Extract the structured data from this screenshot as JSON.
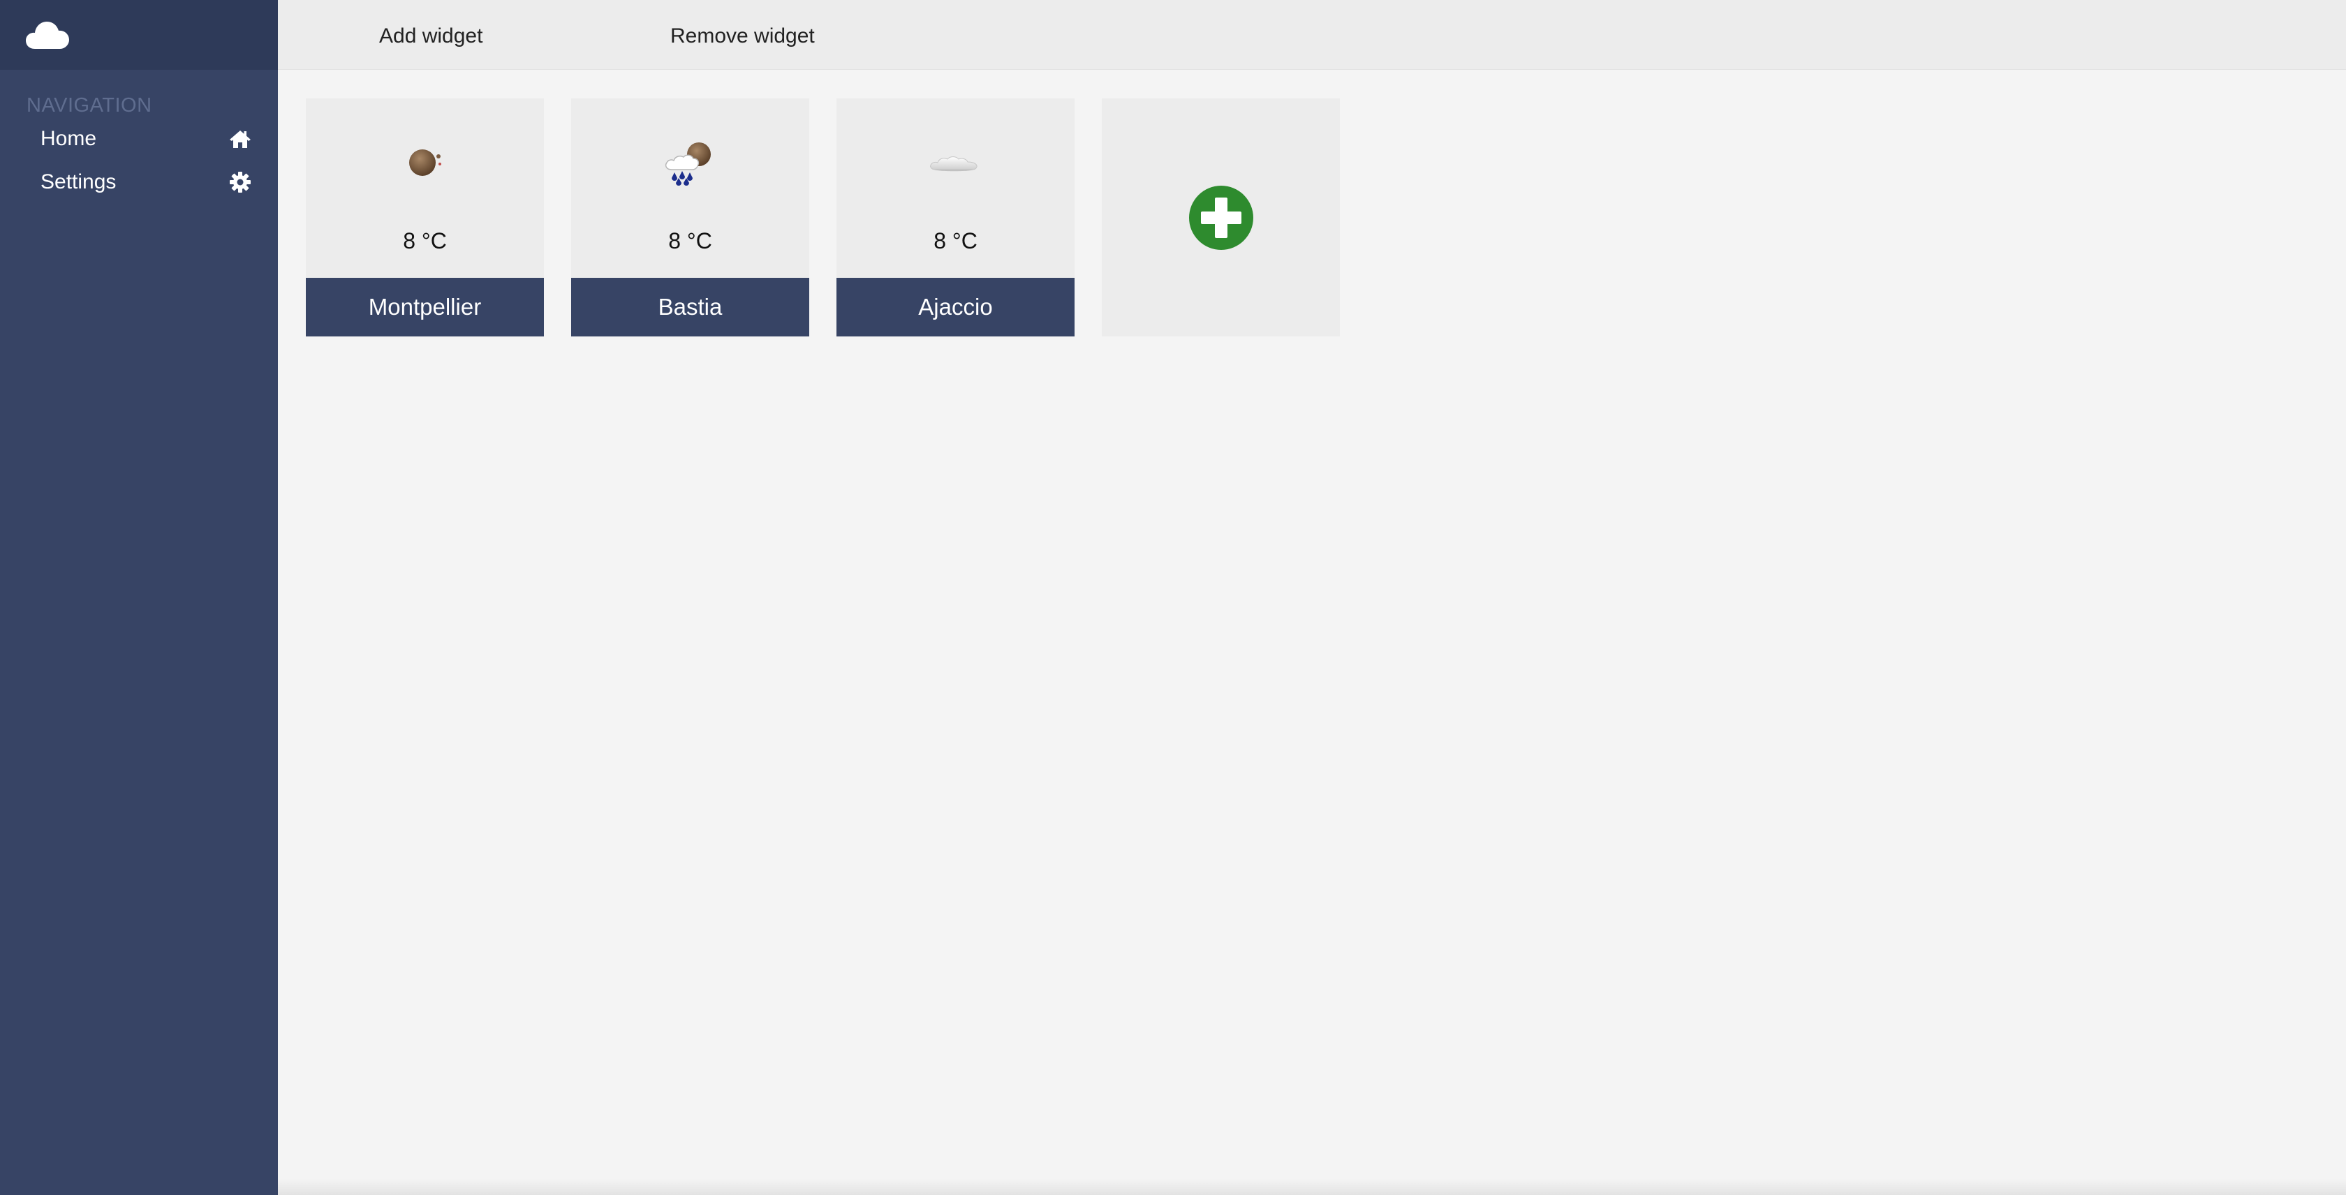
{
  "sidebar": {
    "brand_icon": "cloud-icon",
    "heading": "NAVIGATION",
    "items": [
      {
        "label": "Home",
        "icon": "home-icon"
      },
      {
        "label": "Settings",
        "icon": "gear-icon"
      }
    ]
  },
  "toolbar": {
    "add_label": "Add widget",
    "remove_label": "Remove widget"
  },
  "widgets": [
    {
      "city": "Montpellier",
      "temp": "8 °C",
      "icon": "moon-night-icon"
    },
    {
      "city": "Bastia",
      "temp": "8 °C",
      "icon": "rain-night-icon"
    },
    {
      "city": "Ajaccio",
      "temp": "8 °C",
      "icon": "cloud-icon"
    }
  ],
  "add_tile": {
    "icon": "add-circle-icon"
  },
  "colors": {
    "sidebar": "#374465",
    "sidebar_brand": "#2e3a59",
    "city_bar": "#374465",
    "add_green": "#2e8b2e",
    "background": "#f4f4f4",
    "widget_bg": "#ececec"
  }
}
